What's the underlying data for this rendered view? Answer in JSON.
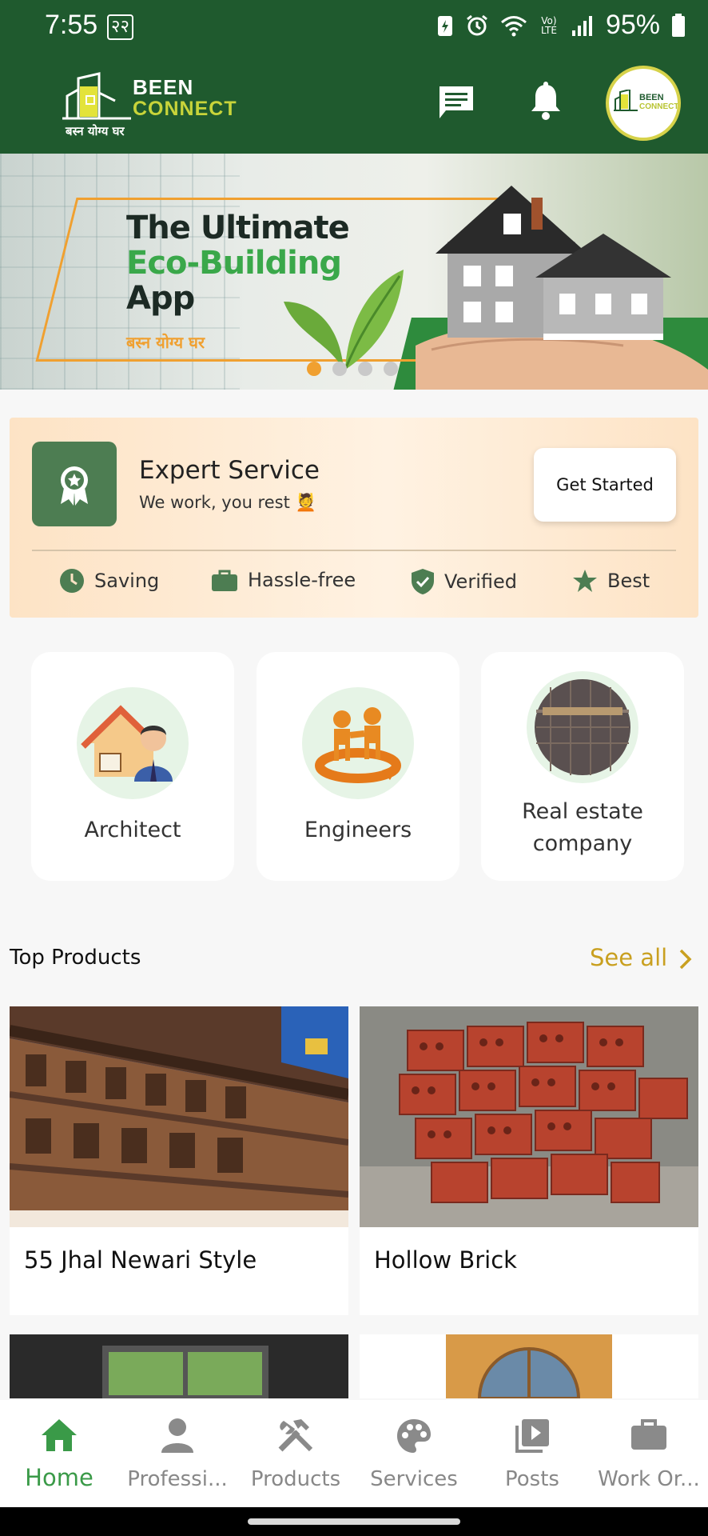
{
  "status_bar": {
    "time": "7:55",
    "nepali_badge": "२२",
    "battery": "95%",
    "network": "Vo) LTE"
  },
  "header": {
    "logo_been": "BEEN",
    "logo_connect": "CONNECT",
    "logo_tagline": "बस्न योग्य घर",
    "avatar_been": "BEEN",
    "avatar_connect": "CONNECT"
  },
  "banner": {
    "line1": "The Ultimate",
    "line2": "Eco-Building",
    "line3": "App",
    "tagline": "बस्न योग्य घर",
    "slide_count": 4,
    "active_slide": 1
  },
  "expert": {
    "title": "Expert Service",
    "subtitle": "We work, you rest 💆",
    "cta": "Get Started",
    "features": [
      "Saving",
      "Hassle-free",
      "Verified",
      "Best"
    ]
  },
  "categories": [
    {
      "label": "Architect"
    },
    {
      "label": "Engineers"
    },
    {
      "label": "Real estate company"
    }
  ],
  "top_products": {
    "title": "Top Products",
    "see_all": "See all",
    "items": [
      {
        "name": "55 Jhal Newari Style"
      },
      {
        "name": "Hollow Brick"
      }
    ]
  },
  "bottom_nav": {
    "items": [
      {
        "label": "Home",
        "icon": "home-icon",
        "active": true
      },
      {
        "label": "Professi...",
        "icon": "person-icon"
      },
      {
        "label": "Products",
        "icon": "tools-icon"
      },
      {
        "label": "Services",
        "icon": "palette-icon"
      },
      {
        "label": "Posts",
        "icon": "video-library-icon"
      },
      {
        "label": "Work Or...",
        "icon": "briefcase-icon"
      }
    ]
  },
  "colors": {
    "primary": "#1f5a2e",
    "accent": "#3a9a48",
    "gold": "#c9a020",
    "orange": "#f0a030"
  }
}
